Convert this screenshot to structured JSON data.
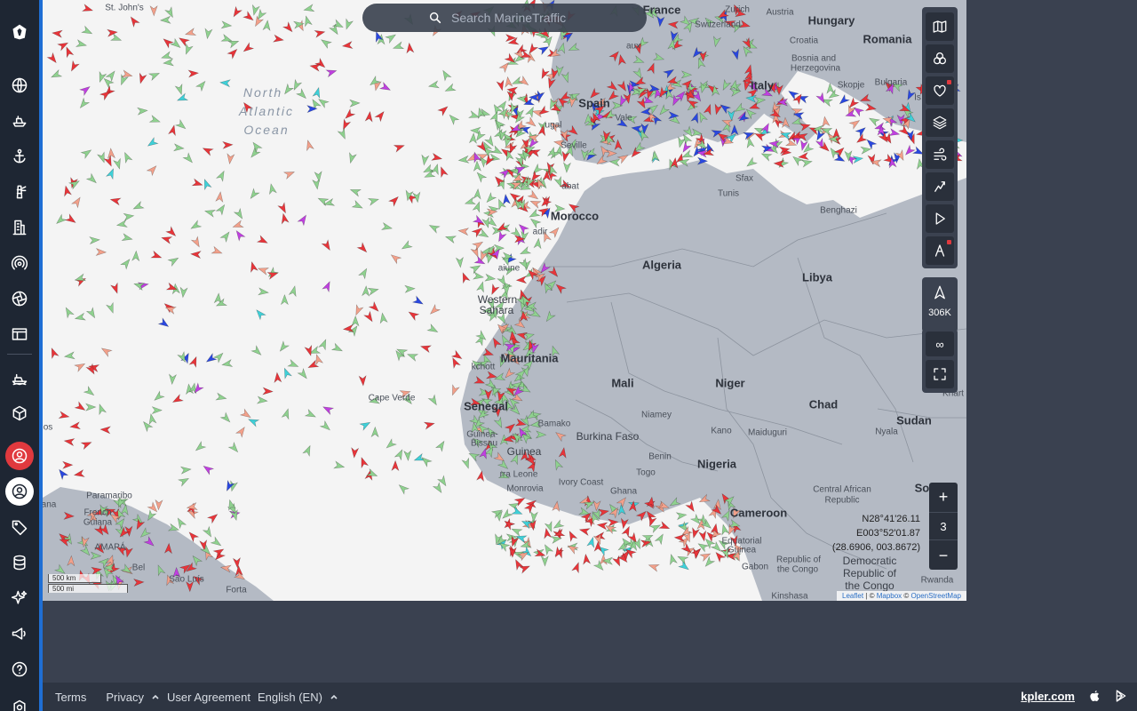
{
  "search": {
    "placeholder": "Search MarineTraffic"
  },
  "sidebar": {
    "items": [
      {
        "name": "logo-icon"
      },
      {
        "name": "live-map-icon"
      },
      {
        "name": "vessels-icon"
      },
      {
        "name": "ports-icon"
      },
      {
        "name": "lighthouse-icon"
      },
      {
        "name": "companies-icon"
      },
      {
        "name": "stations-icon"
      },
      {
        "name": "aperture-icon"
      },
      {
        "name": "table-icon"
      },
      {
        "name": "fleet-icon"
      },
      {
        "name": "cube-icon"
      },
      {
        "name": "account-red-icon"
      },
      {
        "name": "account-icon"
      },
      {
        "name": "tag-icon"
      },
      {
        "name": "database-icon"
      },
      {
        "name": "sparkle-icon"
      },
      {
        "name": "megaphone-icon"
      },
      {
        "name": "help-icon"
      },
      {
        "name": "settings-icon"
      }
    ]
  },
  "map": {
    "places": {
      "france": "France",
      "zurich": "Zurich",
      "austria": "Austria",
      "hungary": "Hungary",
      "switzerland": "Switzerland",
      "croatia": "Croatia",
      "romania": "Romania",
      "bosnia1": "Bosnia and",
      "bosnia2": "Herzegovina",
      "bulgaria": "Bulgaria",
      "skopje": "Skopje",
      "italy": "Italy",
      "spain": "Spain",
      "portugal": "ugal",
      "seville": "Seville",
      "valencia": "Vale",
      "bordeaux": "aux",
      "stjohns": "St. John's",
      "north": "North",
      "atlantic": "Atlantic",
      "ocean": "Ocean",
      "tunis": "Tunis",
      "sfax": "Sfax",
      "benghazi": "Benghazi",
      "rabat": "abat",
      "morocco": "Morocco",
      "agadir": "adir",
      "algeria": "Algeria",
      "libya": "Libya",
      "aaiune": "aiune",
      "western1": "Western",
      "western2": "Sahara",
      "mauritania": "Mauritania",
      "nouakchott": "kchott",
      "mali": "Mali",
      "niger": "Niger",
      "chad": "Chad",
      "sudan": "Sudan",
      "capeverde": "Cape Verde",
      "senegal": "Senegal",
      "bamako": "Bamako",
      "niamey": "Niamey",
      "kano": "Kano",
      "maiduguri": "Maiduguri",
      "nyala": "Nyala",
      "guinea_b1": "Guinea-",
      "guinea_b2": "Bissau",
      "burkina": "Burkina Faso",
      "guinea": "Guinea",
      "benin": "Benin",
      "nigeria": "Nigeria",
      "sierra": "rra Leone",
      "togo": "Togo",
      "monrovia": "Monrovia",
      "ivory": "Ivory Coast",
      "ghana": "Ghana",
      "car1": "Central African",
      "car2": "Republic",
      "south": "South",
      "cameroon": "Cameroon",
      "eqg1": "Equatorial",
      "eqg2": "Guinea",
      "gabon": "Gabon",
      "roc1": "Republic of",
      "roc2": "the Congo",
      "drc1": "Democratic",
      "drc2": "Republic of",
      "drc3": "the Congo",
      "rwanda": "Rwanda",
      "kinshasa": "Kinshasa",
      "paramaribo": "Paramaribo",
      "french_guiana1": "French",
      "french_guiana2": "Guiana",
      "amapa": "AMAPÁ",
      "belem": "Bel",
      "saoluis": "São Luís",
      "fortaleza": "Forta",
      "guyana": "ana",
      "khartoum": "Khart",
      "cos": "os",
      "na": "na",
      "ol": "Mol",
      "dova": "Is"
    },
    "scale": {
      "km": "500 km",
      "mi": "500 mi"
    },
    "attribution": {
      "leaflet": "Leaflet",
      "sep1": " | © ",
      "mapbox": "Mapbox",
      "sep2": " © ",
      "osm": "OpenStreetMap"
    },
    "colors": {
      "land": "#b4bac4",
      "sea": "#f4f4f4",
      "border": "#8c939e",
      "cargo": "#8fd18f",
      "tanker": "#e8353a",
      "passenger": "#2a48e0",
      "fishing": "#f2a08a",
      "tug": "#3fd0d8",
      "pleasure": "#c040e0",
      "highspeed": "#f0c020"
    }
  },
  "toolbar": {
    "tools": [
      "map-icon",
      "filter-circles-icon",
      "favorites-icon",
      "layers-icon",
      "weather-icon",
      "density-icon",
      "playback-icon",
      "measure-icon"
    ],
    "vessel_count": "306K",
    "infinity": "∞"
  },
  "zoom": {
    "in": "+",
    "level": "3",
    "out": "−"
  },
  "coords": {
    "lat": "N28°41'26.11",
    "lon": "E003°52'01.87",
    "decimal": "(28.6906, 003.8672)"
  },
  "footer": {
    "terms": "Terms",
    "privacy": "Privacy",
    "agreement": "User Agreement",
    "language": "English (EN)",
    "kpler": "kpler.com"
  }
}
